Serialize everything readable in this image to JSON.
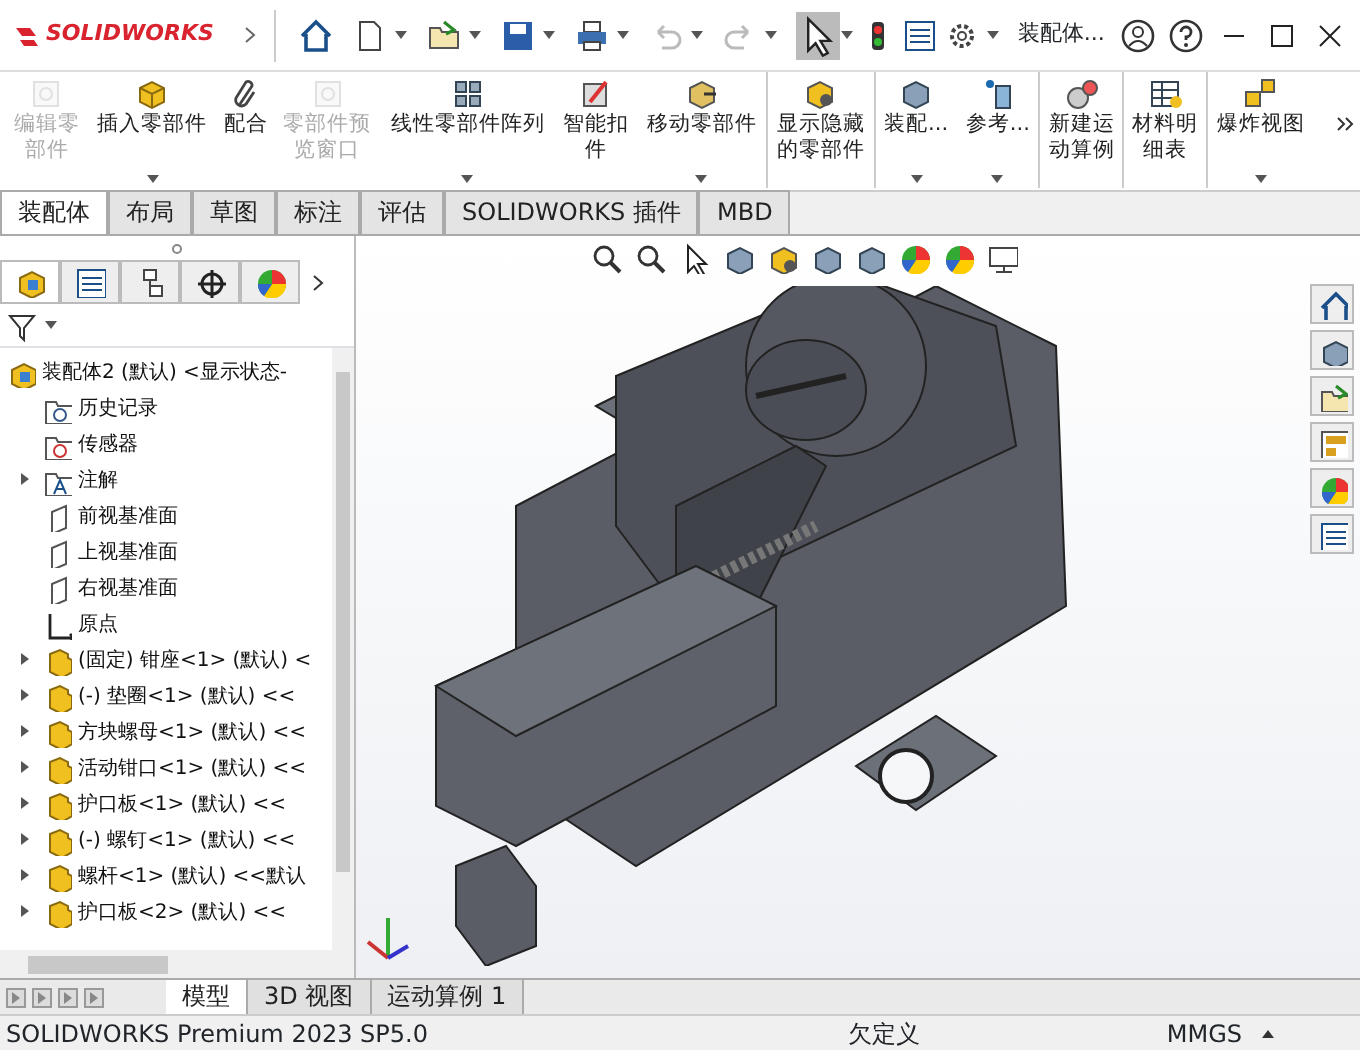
{
  "title_bar": {
    "logo": "SOLIDWORKS",
    "document_title": "装配体..."
  },
  "ribbon": [
    {
      "label": "编辑零部件",
      "disabled": true,
      "dropdown": false,
      "separator_before": false
    },
    {
      "label": "插入零部件",
      "disabled": false,
      "dropdown": true,
      "separator_before": false
    },
    {
      "label": "配合",
      "disabled": false,
      "dropdown": false,
      "separator_before": false
    },
    {
      "label": "零部件预览窗口",
      "disabled": true,
      "dropdown": false,
      "separator_before": false
    },
    {
      "label": "线性零部件阵列",
      "disabled": false,
      "dropdown": true,
      "separator_before": false
    },
    {
      "label": "智能扣件",
      "disabled": false,
      "dropdown": false,
      "separator_before": false
    },
    {
      "label": "移动零部件",
      "disabled": false,
      "dropdown": true,
      "separator_before": false
    },
    {
      "label": "显示隐藏的零部件",
      "disabled": false,
      "dropdown": false,
      "separator_before": true
    },
    {
      "label": "装配...",
      "disabled": false,
      "dropdown": true,
      "separator_before": true
    },
    {
      "label": "参考...",
      "disabled": false,
      "dropdown": true,
      "separator_before": false
    },
    {
      "label": "新建运动算例",
      "disabled": false,
      "dropdown": false,
      "separator_before": true
    },
    {
      "label": "材料明细表",
      "disabled": false,
      "dropdown": false,
      "separator_before": true
    },
    {
      "label": "爆炸视图",
      "disabled": false,
      "dropdown": true,
      "separator_before": true
    }
  ],
  "tabs": [
    {
      "label": "装配体",
      "selected": true
    },
    {
      "label": "布局",
      "selected": false
    },
    {
      "label": "草图",
      "selected": false
    },
    {
      "label": "标注",
      "selected": false
    },
    {
      "label": "评估",
      "selected": false
    },
    {
      "label": "SOLIDWORKS 插件",
      "selected": false
    },
    {
      "label": "MBD",
      "selected": false
    }
  ],
  "panel_tabs": [
    {
      "selected": true
    },
    {
      "selected": false
    },
    {
      "selected": false
    },
    {
      "selected": false
    },
    {
      "selected": false
    }
  ],
  "feature_tree": {
    "root": "装配体2 (默认) <显示状态-",
    "items": [
      {
        "kind": "history",
        "label": "历史记录",
        "expandable": false
      },
      {
        "kind": "sensor",
        "label": "传感器",
        "expandable": false
      },
      {
        "kind": "annotation",
        "label": "注解",
        "expandable": true
      },
      {
        "kind": "plane",
        "label": "前视基准面",
        "expandable": false
      },
      {
        "kind": "plane",
        "label": "上视基准面",
        "expandable": false
      },
      {
        "kind": "plane",
        "label": "右视基准面",
        "expandable": false
      },
      {
        "kind": "origin",
        "label": "原点",
        "expandable": false
      },
      {
        "kind": "part",
        "label": "(固定) 钳座<1> (默认) <",
        "expandable": true
      },
      {
        "kind": "part",
        "label": "(-) 垫圈<1> (默认) <<",
        "expandable": true
      },
      {
        "kind": "part",
        "label": "方块螺母<1> (默认) <<",
        "expandable": true
      },
      {
        "kind": "part",
        "label": "活动钳口<1> (默认) <<",
        "expandable": true
      },
      {
        "kind": "part",
        "label": "护口板<1> (默认) <<",
        "expandable": true
      },
      {
        "kind": "part",
        "label": "(-) 螺钉<1> (默认) <<",
        "expandable": true
      },
      {
        "kind": "part",
        "label": "螺杆<1> (默认) <<默认",
        "expandable": true
      },
      {
        "kind": "part",
        "label": "护口板<2> (默认) <<",
        "expandable": true
      }
    ]
  },
  "bottom_tabs": [
    {
      "label": "模型",
      "selected": true
    },
    {
      "label": "3D 视图",
      "selected": false
    },
    {
      "label": "运动算例 1",
      "selected": false
    }
  ],
  "status_bar": {
    "product": "SOLIDWORKS Premium 2023 SP5.0",
    "state": "欠定义",
    "units": "MMGS"
  }
}
